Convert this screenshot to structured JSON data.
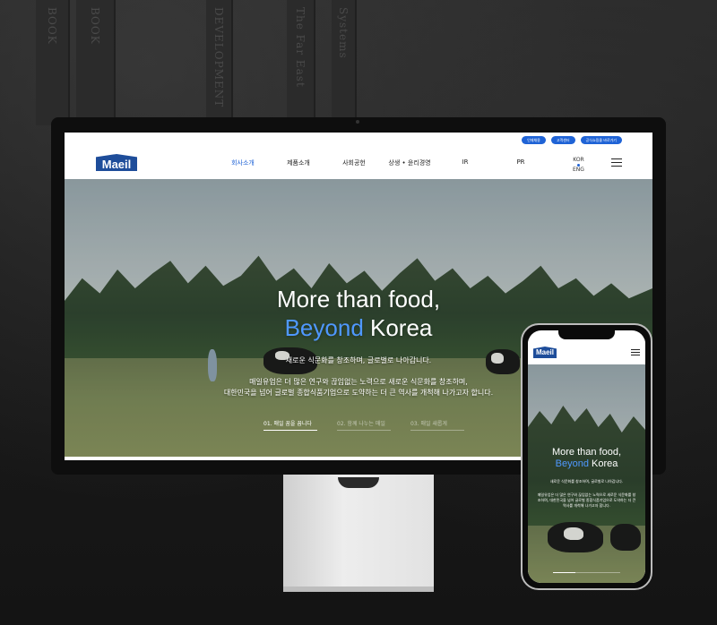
{
  "backdrop": {
    "book_titles": [
      "BOOK",
      "BOOK",
      "DEVELOPMENT",
      "Systems",
      "The Far East"
    ]
  },
  "colors": {
    "brand_blue": "#1e4d9a",
    "accent_blue": "#1f63d6",
    "hero_highlight": "#4f98ff"
  },
  "site": {
    "logo_text": "Maeil",
    "utility_links": [
      "인재채용",
      "고객센터",
      "공식쇼핑몰 바로가기"
    ],
    "nav_items": [
      "회사소개",
      "제품소개",
      "사회공헌",
      "상생 • 윤리경영",
      "IR",
      "PR"
    ],
    "active_nav": "회사소개",
    "lang": {
      "primary": "KOR",
      "secondary": "ENG"
    },
    "menu_icon": "hamburger-icon"
  },
  "hero": {
    "title_line1": "More than food,",
    "title_line2_highlight": "Beyond",
    "title_line2_rest": " Korea",
    "sub1": "새로운 식문화를 창조하며, 글로벌로 나아갑니다.",
    "sub2_line1": "매일유업은 더 많은 연구와 끊임없는 노력으로 새로운 식문화를 창조하며,",
    "sub2_line2": "대한민국을 넘어 글로벌 종합식품기업으로 도약하는 더 큰 역사를 개척해 나가고자 합니다.",
    "tabs": [
      "01. 매일 꿈을 꿉니다",
      "02. 함께 나누는 매일",
      "03. 매일 새롭게"
    ]
  },
  "mobile": {
    "logo_text": "Maeil",
    "title_line1": "More than food,",
    "title_line2_highlight": "Beyond",
    "title_line2_rest": " Korea",
    "sub1": "새로운 식문화를 창조하며, 글로벌로 나아갑니다.",
    "sub2": "매일유업은 더 많은 연구와 끊임없는 노력으로 새로운 식문화를 창조하며, 대한민국을 넘어 글로벌 종합식품기업으로 도약하는 더 큰 역사를 개척해 나가고자 합니다."
  }
}
